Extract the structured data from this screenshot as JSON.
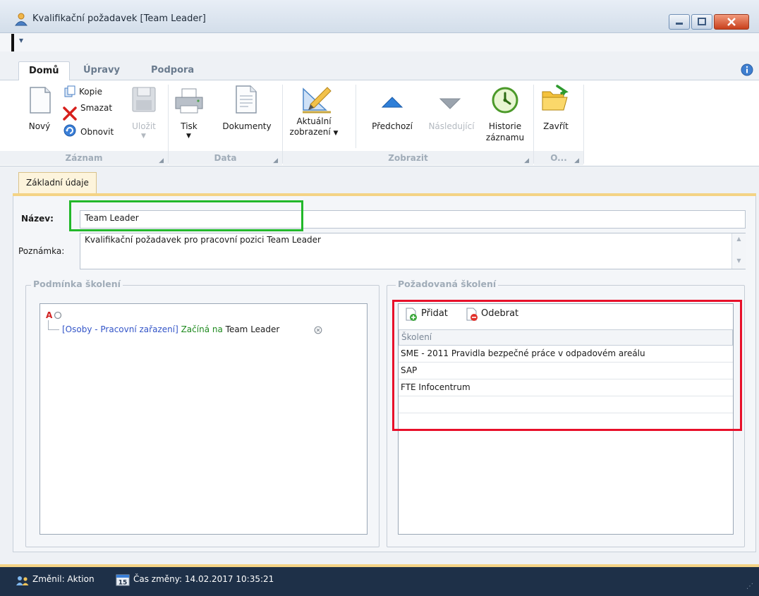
{
  "window": {
    "title": "Kvalifikační požadavek [Team Leader]",
    "qat_arrow": "▾"
  },
  "ribbon": {
    "tabs": [
      {
        "label": "Domů",
        "active": true
      },
      {
        "label": "Úpravy",
        "active": false
      },
      {
        "label": "Podpora",
        "active": false
      }
    ],
    "record": {
      "new_label": "Nový",
      "copy_label": "Kopie",
      "delete_label": "Smazat",
      "refresh_label": "Obnovit",
      "save_label": "Uložit",
      "group_label": "Záznam"
    },
    "data": {
      "print_label": "Tisk",
      "documents_label": "Dokumenty",
      "group_label": "Data"
    },
    "view": {
      "current_view_line1": "Aktuální",
      "current_view_line2": "zobrazení",
      "previous_label": "Předchozí",
      "next_label": "Následující",
      "history_line1": "Historie",
      "history_line2": "záznamu",
      "group_label": "Zobrazit"
    },
    "other": {
      "close_label": "Zavřít",
      "group_label": "O..."
    }
  },
  "form": {
    "tab_label": "Základní údaje",
    "name_label": "Název:",
    "name_value": "Team Leader",
    "note_label": "Poznámka:",
    "note_value": "Kvalifikační požadavek pro pracovní pozici Team Leader",
    "condition": {
      "legend": "Podmínka školení",
      "root_letter": "A",
      "field": "[Osoby - Pracovní zařazení]",
      "operator": "Začíná na",
      "value": "Team Leader"
    },
    "required_trainings": {
      "legend": "Požadovaná školení",
      "add_label": "Přidat",
      "remove_label": "Odebrat",
      "column_header": "Školení",
      "rows": [
        "SME - 2011 Pravidla bezpečné práce v odpadovém areálu",
        "SAP",
        "FTE Infocentrum"
      ]
    }
  },
  "status": {
    "changed_by": "Změnil: Aktion",
    "changed_time": "Čas změny: 14.02.2017 10:35:21"
  },
  "colors": {
    "highlight_green": "#22b82a",
    "highlight_red": "#e8102a",
    "accent_gold": "#f4d385",
    "status_bg": "#1e3048"
  }
}
